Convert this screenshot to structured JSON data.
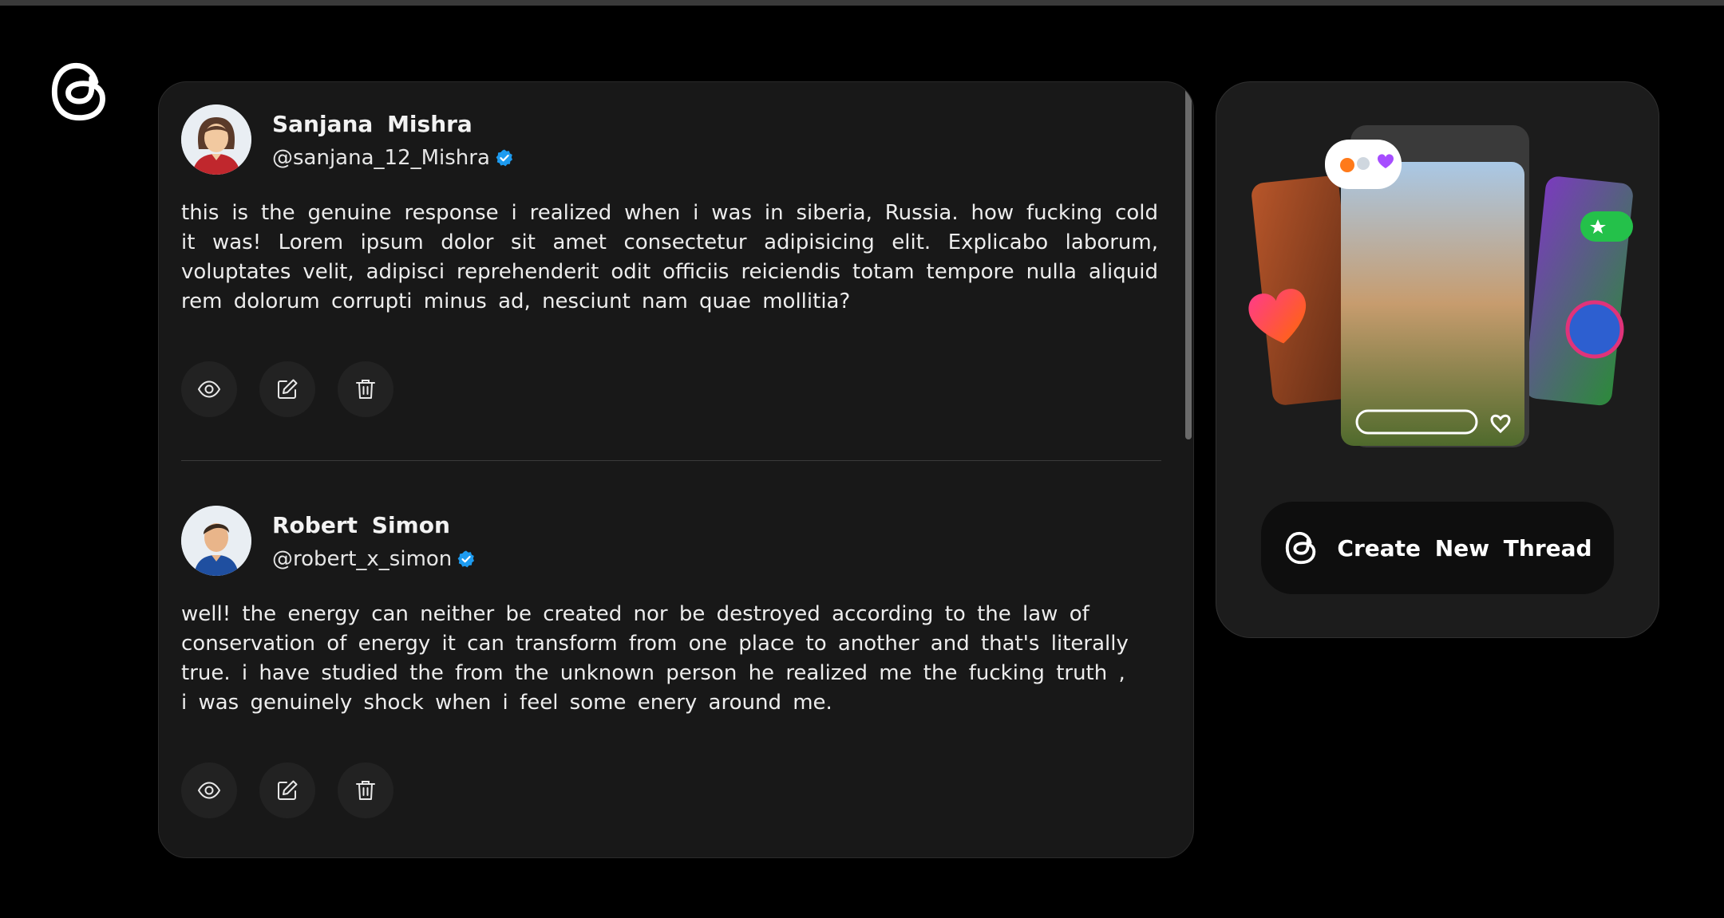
{
  "app": {
    "logo": "threads-logo-icon"
  },
  "posts": [
    {
      "name": "Sanjana  Mishra",
      "handle": "@sanjana_12_Mishra",
      "text": "this is the genuine response i realized when i was in siberia, Russia. how fucking cold it was! Lorem ipsum dolor sit amet consectetur adipisicing elit. Explicabo laborum, voluptates velit, adipisci reprehenderit odit officiis reiciendis totam tempore nulla aliquid rem dolorum corrupti minus ad, nesciunt nam quae mollitia?",
      "avatar": "female-avatar"
    },
    {
      "name": "Robert  Simon",
      "handle": "@robert_x_simon",
      "text": "well! the energy can neither be created nor be destroyed according to the law of conservation of energy it can transform from one place to another and that's literally true. i have studied the from the unknown person he realized me the fucking truth , i was genuinely shock when i feel some enery around me.",
      "avatar": "male-avatar"
    }
  ],
  "actions": {
    "view": "eye-icon",
    "edit": "edit-icon",
    "delete": "trash-icon"
  },
  "sidebar": {
    "create_label": "Create  New  Thread"
  },
  "colors": {
    "background": "#000000",
    "card": "#181818",
    "verified": "#1d9bf0"
  }
}
